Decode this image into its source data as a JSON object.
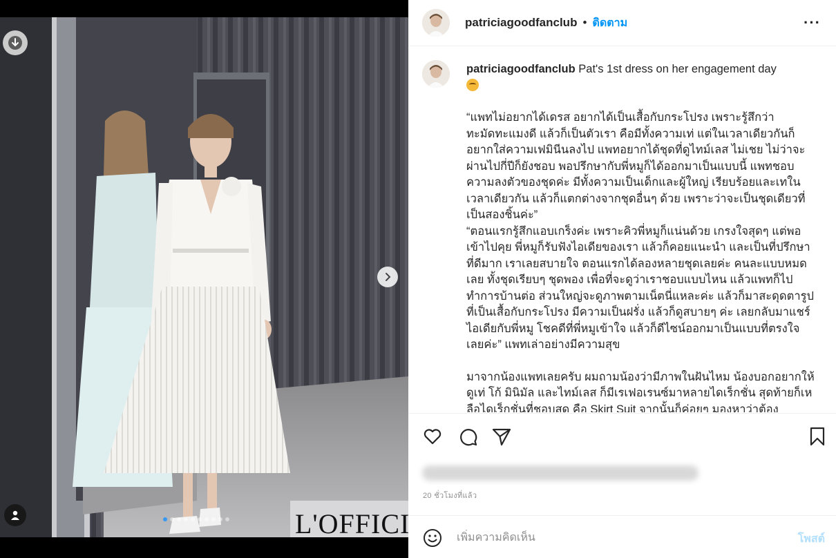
{
  "media": {
    "magazine_logo": "L'OFFICIEL",
    "carousel_dots": 10,
    "active_dot": 0,
    "icons": {
      "download": "download-arrow-icon",
      "next": "chevron-right-icon",
      "tag": "user-tag-icon"
    }
  },
  "header": {
    "username": "patriciagoodfanclub",
    "separator": "•",
    "follow_label": "ติดตาม",
    "more_label": "···"
  },
  "caption": {
    "username": "patriciagoodfanclub",
    "headline": "Pat's 1st dress on her engagement day",
    "trailing_glyph": "🫣",
    "paragraphs": [
      "“แพทไม่อยากได้เดรส อยากได้เป็นเสื้อกับกระโปรง เพราะรู้สึกว่าทะมัดทะแมงดี แล้วก็เป็นตัวเรา คือมีทั้งความเท่ แต่ในเวลาเดียวกันก็อยากใส่ความเฟมินีนลงไป แพทอยากได้ชุดที่ดูไทม์เลส ไม่เชย ไม่ว่าจะผ่านไปกี่ปีก็ยังชอบ พอปรึกษากับพี่หมูก็ได้ออกมาเป็นแบบนี้ แพทชอบความลงตัวของชุดค่ะ มีทั้งความเป็นเด็กและผู้ใหญ่ เรียบร้อยและเทในเวลาเดียวกัน แล้วก็แตกต่างจากชุดอื่นๆ ด้วย เพราะว่าจะเป็นชุดเดียวที่เป็นสองชิ้นค่ะ”",
      "“ตอนแรกรู้สึกแอบเกร็งค่ะ เพราะคิวพี่หมูก็แน่นด้วย เกรงใจสุดๆ แต่พอเข้าไปคุย พี่หมูก็รับฟังไอเดียของเรา แล้วก็คอยแนะนำ และเป็นที่ปรึกษาที่ดีมาก เราเลยสบายใจ ตอนแรกได้ลองหลายชุดเลยค่ะ คนละแบบหมดเลย ทั้งชุดเรียบๆ ชุดพอง เพื่อที่จะดูว่าเราชอบแบบไหน แล้วแพทก็ไปทำการบ้านต่อ ส่วนใหญ่จะดูภาพตามเน็ตนี่แหละค่ะ แล้วก็มาสะดุดตารูปที่เป็นเสื้อกับกระโปรง มีความเป็นฝรั่ง แล้วก็ดูสบายๆ ค่ะ เลยกลับมาแชร์ไอเดียกับพี่หมู โชคดีที่พี่หมูเข้าใจ แล้วก็ดีไซน์ออกมาเป็นแบบที่ตรงใจเลยค่ะ” แพทเล่าอย่างมีความสุข",
      "มาจากน้องแพทเลยครับ ผมถามน้องว่ามีภาพในฝันไหม น้องบอกอยากให้ดูเท่ โก้ มินิมัล และไทม์เลส ก็มีเรเฟอเรนซ์มาหลายไดเร็กชั่น สุดท้ายก็เหลือไดเร็กชั่นที่ชอบสุด คือ Skirt Suit จากนั้นก็ค่อยๆ มองหาว่าต้อง"
    ]
  },
  "actions": {
    "like": "heart-icon",
    "comment": "comment-bubble-icon",
    "share": "paper-plane-icon",
    "save": "bookmark-icon"
  },
  "meta": {
    "time_ago": "20 ชั่วโมงที่แล้ว"
  },
  "comment": {
    "placeholder": "เพิ่มความคิดเห็น",
    "post_label": "โพสต์",
    "emoji_icon": "smiley-icon"
  }
}
